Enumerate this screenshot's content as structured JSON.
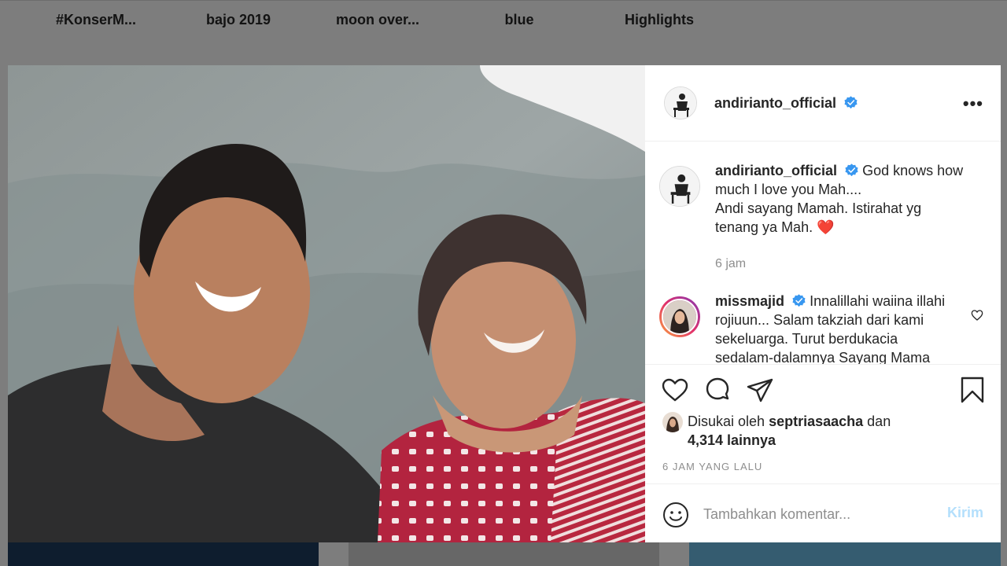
{
  "highlights": [
    "#KonserM...",
    "bajo 2019",
    "moon over...",
    "blue",
    "Highlights"
  ],
  "post": {
    "username": "andirianto_official",
    "caption_lines": [
      "God knows how",
      "much I love you Mah....",
      "Andi sayang Mamah. Istirahat yg",
      "tenang ya Mah. ❤️"
    ],
    "caption_time": "6 jam",
    "comment": {
      "username": "missmajid",
      "lines": [
        "Innalillahi waiina illahi",
        "rojiuun... Salam takziah dari kami",
        "sekeluarga. Turut berdukacia",
        "sedalam-dalamnya Sayang Mama"
      ]
    },
    "likes": {
      "prefix": "Disukai oleh",
      "liker": "septriasaacha",
      "joiner": "dan",
      "count": "4,314 lainnya"
    },
    "posted_ago": "6 JAM YANG LALU",
    "add_comment": {
      "placeholder": "Tambahkan komentar...",
      "post_label": "Kirim"
    }
  },
  "colors": {
    "verified": "#3897f0",
    "post_button_disabled": "#b3dffc",
    "heart_red": "#ed4956"
  },
  "icons": [
    "verified-badge-icon",
    "more-options-icon",
    "heart-icon",
    "comment-icon",
    "share-icon",
    "bookmark-icon",
    "emoji-icon"
  ]
}
